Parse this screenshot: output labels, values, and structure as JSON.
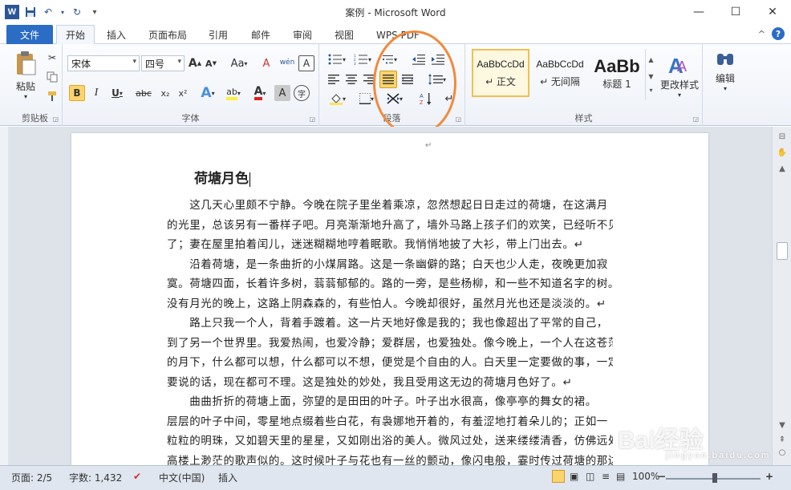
{
  "window": {
    "title": "案例 - Microsoft Word",
    "logo_letter": "W",
    "minimize": "—",
    "maximize": "☐",
    "close": "✕"
  },
  "tabs": [
    {
      "label": "文件"
    },
    {
      "label": "开始"
    },
    {
      "label": "插入"
    },
    {
      "label": "页面布局"
    },
    {
      "label": "引用"
    },
    {
      "label": "邮件"
    },
    {
      "label": "审阅"
    },
    {
      "label": "视图"
    },
    {
      "label": "WPS PDF"
    }
  ],
  "help": {
    "question": "?",
    "collapse": "^"
  },
  "ribbon": {
    "clipboard": {
      "label": "剪贴板",
      "paste": "粘贴"
    },
    "font": {
      "label": "字体",
      "font_name": "宋体",
      "font_size": "四号",
      "bold": "B",
      "italic": "I",
      "underline": "U",
      "strike": "abc",
      "subscript": "x₂",
      "superscript": "x²",
      "grow": "A",
      "shrink": "A",
      "case": "Aa",
      "clear": "A",
      "phonetic": "wén",
      "border_char": "A",
      "effects": "A",
      "highlight": "ab",
      "color": "A",
      "char_shade": "A",
      "enclose": "字"
    },
    "paragraph": {
      "label": "段落"
    },
    "styles": {
      "label": "样式",
      "items": [
        {
          "sample": "AaBbCcDd",
          "name": "↵ 正文"
        },
        {
          "sample": "AaBbCcDd",
          "name": "↵ 无间隔"
        },
        {
          "sample": "AaBb",
          "name": "标题 1"
        }
      ],
      "change_styles": "更改样式"
    },
    "editing": {
      "label": "编辑"
    }
  },
  "document": {
    "top_mark": "↵",
    "title": "荷塘月色",
    "lines": [
      "　　这几天心里颇不宁静。今晚在院子里坐着乘凉，忽然想起日日走过的荷塘，在这满月",
      "的光里，总该另有一番样子吧。月亮渐渐地升高了，墙外马路上孩子们的欢笑，已经听不见",
      "了；妻在屋里拍着闰儿，迷迷糊糊地哼着眠歌。我悄悄地披了大衫，带上门出去。↵",
      "　　沿着荷塘，是一条曲折的小煤屑路。这是一条幽僻的路；白天也少人走，夜晚更加寂",
      "寞。荷塘四面，长着许多树，蓊蓊郁郁的。路的一旁，是些杨柳，和一些不知道名字的树。",
      "没有月光的晚上，这路上阴森森的，有些怕人。今晚却很好，虽然月光也还是淡淡的。↵",
      "　　路上只我一个人，背着手踱着。这一片天地好像是我的；我也像超出了平常的自己，",
      "到了另一个世界里。我爱热闹，也爱冷静；爱群居，也爱独处。像今晚上，一个人在这苍茫",
      "的月下，什么都可以想，什么都可以不想，便觉是个自由的人。白天里一定要做的事，一定",
      "要说的话，现在都可不理。这是独处的妙处，我且受用这无边的荷塘月色好了。↵",
      "　　曲曲折折的荷塘上面，弥望的是田田的叶子。叶子出水很高，像亭亭的舞女的裙。",
      "层层的叶子中间，零星地点缀着些白花，有袅娜地开着的，有羞涩地打着朵儿的；正如一",
      "粒粒的明珠，又如碧天里的星星，又如刚出浴的美人。微风过处，送来缕缕清香，仿佛远处",
      "高楼上渺茫的歌声似的。这时候叶子与花也有一丝的颤动，像闪电般，霎时传过荷塘的那边"
    ]
  },
  "status": {
    "page": "页面: 2/5",
    "words": "字数: 1,432",
    "language": "中文(中国)",
    "mode": "插入",
    "zoom": "100%",
    "zoom_minus": "−",
    "zoom_plus": "+"
  },
  "watermark": {
    "text": "Bai经验",
    "sub": "jingyan.baidu.com"
  },
  "colors": {
    "accent": "#2b6cc4",
    "annotation": "#f08a3c",
    "highlight": "#fbd56b"
  }
}
